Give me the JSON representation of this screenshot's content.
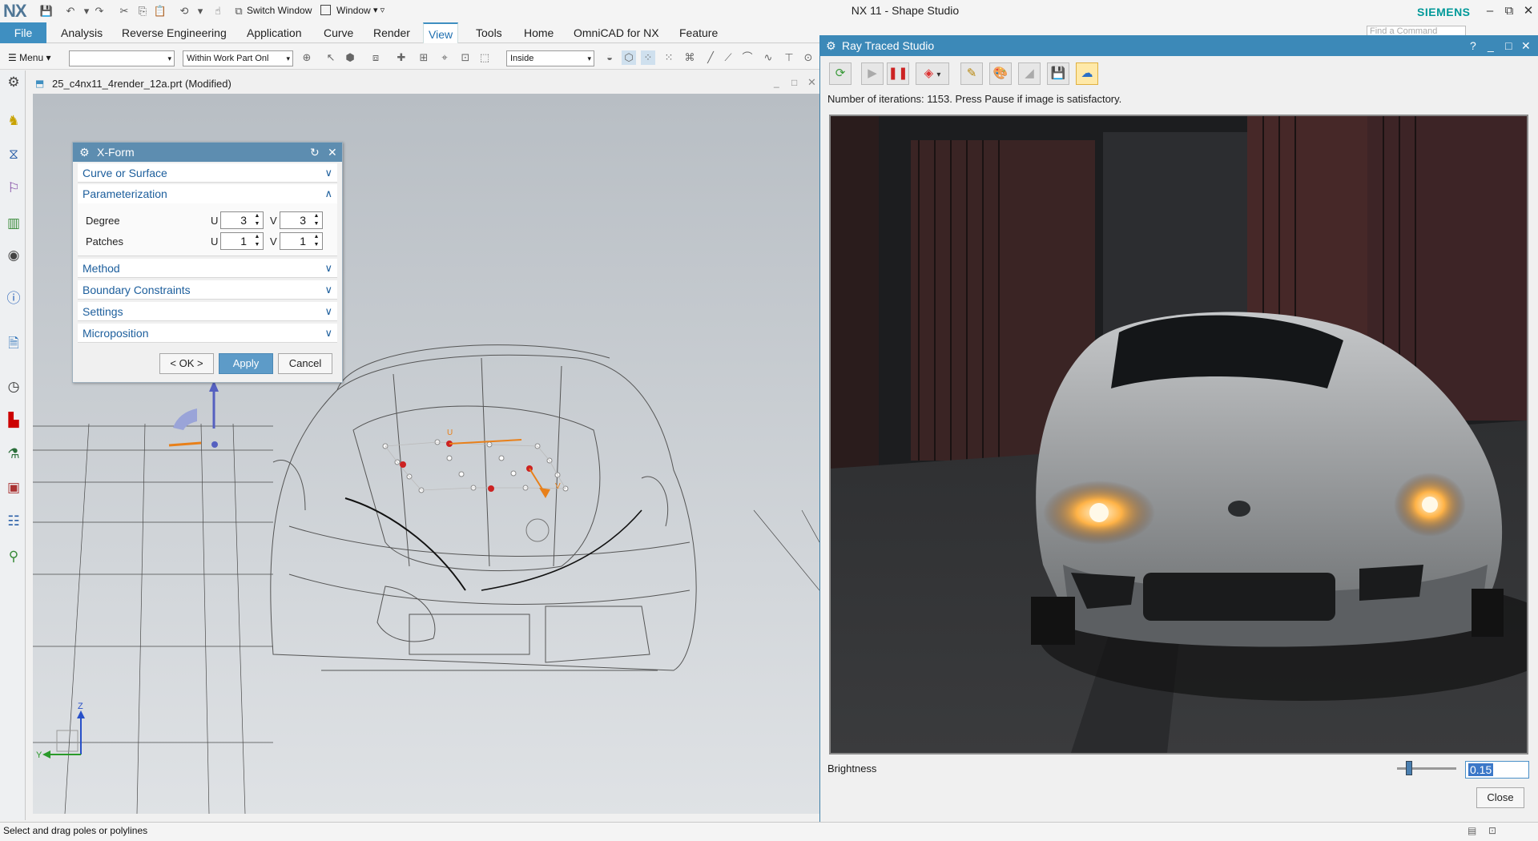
{
  "app": {
    "logo": "NX",
    "title": "NX 11 - Shape Studio",
    "brand": "SIEMENS"
  },
  "quick_access": {
    "switch_window": "Switch Window",
    "window_menu": "Window"
  },
  "window_controls": {
    "minimize_icon": "–",
    "restore_icon": "⧉",
    "close_icon": "✕"
  },
  "menu": {
    "file": "File",
    "tabs": [
      "Analysis",
      "Reverse Engineering",
      "Application",
      "Curve",
      "Render",
      "View",
      "Tools",
      "Home",
      "OmniCAD for NX",
      "Feature"
    ],
    "active_tab": "View",
    "find_command_placeholder": "Find a Command"
  },
  "toolbar": {
    "menu_label": "Menu",
    "filter_value": "",
    "scope_value": "Within Work Part Onl",
    "mode_value": "Inside"
  },
  "document": {
    "tab_title": "25_c4nx11_4render_12a.prt (Modified)"
  },
  "xform": {
    "title": "X-Form",
    "sections": {
      "curve_surface": "Curve or Surface",
      "parameterization": "Parameterization",
      "method": "Method",
      "boundary": "Boundary Constraints",
      "settings": "Settings",
      "microposition": "Microposition"
    },
    "degree_label": "Degree",
    "patches_label": "Patches",
    "u": "U",
    "v": "V",
    "degree_u": "3",
    "degree_v": "3",
    "patches_u": "1",
    "patches_v": "1",
    "ok": "< OK >",
    "apply": "Apply",
    "cancel": "Cancel"
  },
  "viewport": {
    "triad_z": "Z",
    "triad_y": "Y",
    "handle_u": "U",
    "handle_v": "V"
  },
  "ray_traced_studio": {
    "title": "Ray Traced Studio",
    "iterations_text": "Number of iterations: 1153.  Press Pause if image is satisfactory.",
    "brightness_label": "Brightness",
    "brightness_value": "0.15",
    "close": "Close",
    "help": "?"
  },
  "status": {
    "message": "Select and drag poles or polylines"
  },
  "colors": {
    "accent": "#3f8fc1",
    "dialog_header": "#5d8db0",
    "section_text": "#1c5e9c",
    "rts_header": "#3c89b8",
    "headlight": "#ffb347"
  }
}
